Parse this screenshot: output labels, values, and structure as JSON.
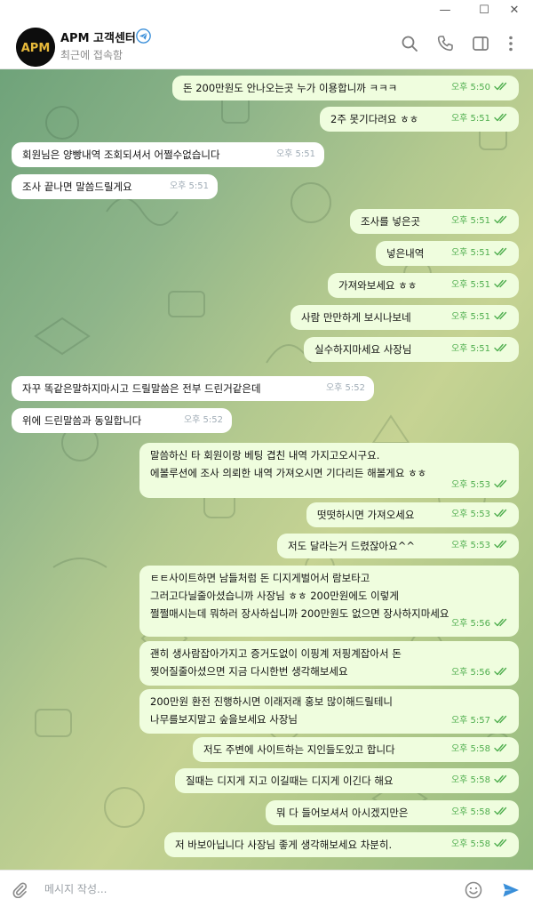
{
  "window_controls": {
    "minimize": "—",
    "maximize": "☐",
    "close": "✕"
  },
  "header": {
    "title": "APM 고객센터",
    "status": "최근에 접속함",
    "avatar_text": "APM"
  },
  "messages": [
    {
      "dir": "out",
      "lines": [
        "돈 200만원도 안나오는곳 누가 이용합니까 ㅋㅋㅋ"
      ],
      "time": "오후 5:50",
      "read": true
    },
    {
      "dir": "out",
      "lines": [
        "2주 못기다려요 ㅎㅎ"
      ],
      "time": "오후 5:51",
      "read": true
    },
    {
      "dir": "in",
      "lines": [
        "회원님은 양빵내역 조회되셔서 어쩔수없습니다"
      ],
      "time": "오후 5:51"
    },
    {
      "dir": "in",
      "lines": [
        "조사 끝나면 말씀드릴게요"
      ],
      "time": "오후 5:51"
    },
    {
      "dir": "out",
      "lines": [
        "조사를 넣은곳"
      ],
      "time": "오후 5:51",
      "read": true
    },
    {
      "dir": "out",
      "lines": [
        "넣은내역"
      ],
      "time": "오후 5:51",
      "read": true
    },
    {
      "dir": "out",
      "lines": [
        "가져와보세요 ㅎㅎ"
      ],
      "time": "오후 5:51",
      "read": true
    },
    {
      "dir": "out",
      "lines": [
        "사람 만만하게 보시나보네"
      ],
      "time": "오후 5:51",
      "read": true
    },
    {
      "dir": "out",
      "lines": [
        "실수하지마세요 사장님"
      ],
      "time": "오후 5:51",
      "read": true
    },
    {
      "dir": "in",
      "lines": [
        "자꾸 똑같은말하지마시고 드릴말씀은 전부 드린거같은데"
      ],
      "time": "오후 5:52"
    },
    {
      "dir": "in",
      "lines": [
        "위에 드린말씀과 동일합니다"
      ],
      "time": "오후 5:52"
    },
    {
      "dir": "out",
      "lines": [
        "말씀하신 타 회원이랑 베팅 겹친 내역 가지고오시구요.",
        "에볼루션에 조사 의뢰한 내역 가져오시면 기다리든 해볼게요 ㅎㅎ"
      ],
      "time": "오후 5:53",
      "read": true
    },
    {
      "dir": "out",
      "lines": [
        "떳떳하시면 가져오세요"
      ],
      "time": "오후 5:53",
      "read": true
    },
    {
      "dir": "out",
      "lines": [
        "저도 달라는거 드렸잖아요^^"
      ],
      "time": "오후 5:53",
      "read": true
    },
    {
      "dir": "out",
      "lines": [
        "ㅌㅌ사이트하면 남들처럼 돈 디지게벌어서 람보타고",
        "그러고다닐줄아셨습니까 사장님 ㅎㅎ 200만원에도 이렇게",
        "쩔쩔매시는데 뭐하러 장사하십니까 200만원도 없으면 장사하지마세요"
      ],
      "time": "오후 5:56",
      "read": true
    },
    {
      "dir": "out",
      "lines": [
        "괜히 생사람잡아가지고 증거도없이 이핑계 저핑계잡아서 돈",
        "찢어질줄아셨으면 지금 다시한번 생각해보세요"
      ],
      "time": "오후 5:56",
      "read": true
    },
    {
      "dir": "out",
      "lines": [
        "200만원 환전 진행하시면 이래저래 홍보 많이해드릴테니",
        "나무를보지말고 숲을보세요 사장님"
      ],
      "time": "오후 5:57",
      "read": true
    },
    {
      "dir": "out",
      "lines": [
        "저도 주변에 사이트하는 지인들도있고 합니다"
      ],
      "time": "오후 5:58",
      "read": true
    },
    {
      "dir": "out",
      "lines": [
        "질때는 디지게 지고 이길때는 디지게 이긴다 해요"
      ],
      "time": "오후 5:58",
      "read": true
    },
    {
      "dir": "out",
      "lines": [
        "뭐 다 들어보셔서 아시겠지만은"
      ],
      "time": "오후 5:58",
      "read": true
    },
    {
      "dir": "out",
      "lines": [
        "저 바보아닙니다 사장님 좋게 생각해보세요 차분히."
      ],
      "time": "오후 5:58",
      "read": true
    }
  ],
  "composer": {
    "placeholder": "메시지 작성...",
    "value": ""
  },
  "colors": {
    "outgoing_bubble": "#effdde",
    "incoming_bubble": "#ffffff",
    "meta_green": "#4fae4e",
    "send_blue": "#3a8fd9"
  },
  "icons": [
    "search-icon",
    "phone-icon",
    "sidebar-toggle-icon",
    "more-vertical-icon",
    "paperclip-icon",
    "emoji-icon",
    "send-icon",
    "verified-icon",
    "double-check-icon"
  ]
}
